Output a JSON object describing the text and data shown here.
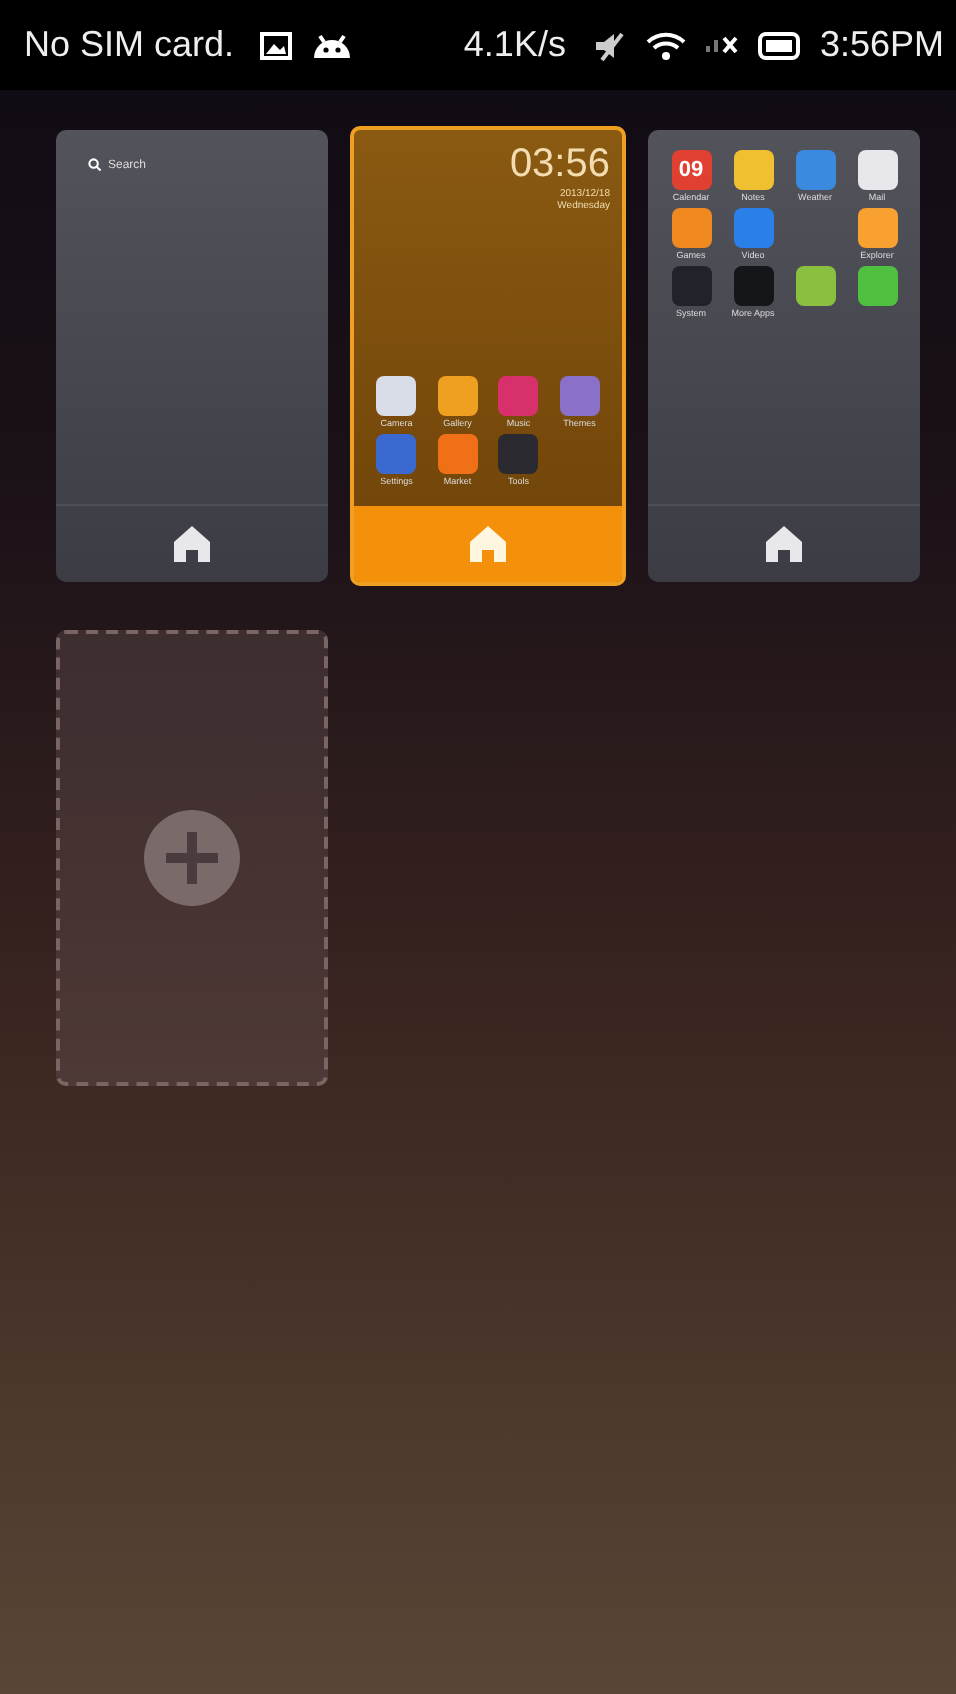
{
  "status_bar": {
    "carrier": "No SIM card.",
    "speed": "4.1K/s",
    "time": "3:56PM"
  },
  "screens": [
    {
      "selected": false,
      "search": "Search"
    },
    {
      "selected": true,
      "clock": {
        "time": "03:56",
        "date": "2013/12/18",
        "day": "Wednesday"
      },
      "apps": [
        {
          "label": "Camera",
          "color": "#d8dce6"
        },
        {
          "label": "Gallery",
          "color": "#f0a020"
        },
        {
          "label": "Music",
          "color": "#d8306a"
        },
        {
          "label": "Themes",
          "color": "#8a70c8"
        },
        {
          "label": "Settings",
          "color": "#3a6ad0"
        },
        {
          "label": "Market",
          "color": "#f07018"
        },
        {
          "label": "Tools",
          "color": "#2a2a30"
        }
      ]
    },
    {
      "selected": false,
      "apps": [
        {
          "label": "Calendar",
          "color": "#e04030",
          "glyph": "09"
        },
        {
          "label": "Notes",
          "color": "#f0c030"
        },
        {
          "label": "Weather",
          "color": "#3a8ae0"
        },
        {
          "label": "Mail",
          "color": "#e8e8ec"
        },
        {
          "label": "Games",
          "color": "#f08a20"
        },
        {
          "label": "Video",
          "color": "#2a80e8"
        },
        {
          "kind": "blank"
        },
        {
          "label": "Explorer",
          "color": "#f8a030"
        },
        {
          "label": "System",
          "color": "#20242a"
        },
        {
          "label": "More Apps",
          "color": "#15161a"
        },
        {
          "color": "#8ac040"
        },
        {
          "color": "#50c040"
        }
      ]
    }
  ],
  "add_screen": true
}
